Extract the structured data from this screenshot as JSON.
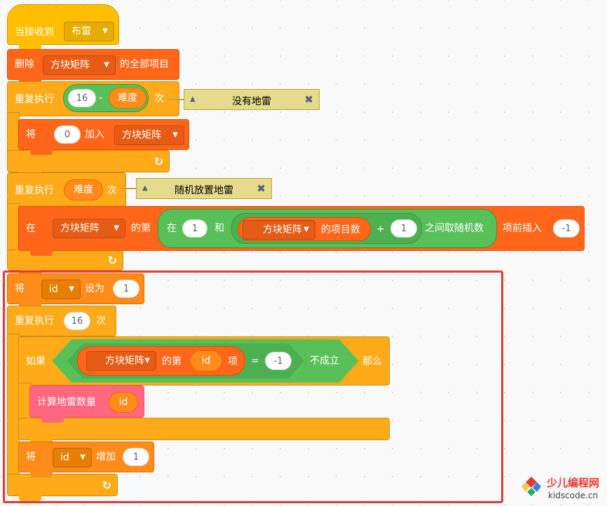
{
  "blocks": {
    "when_receive": {
      "label": "当接收到",
      "message": "布雷"
    },
    "delete_all": {
      "label": "删除",
      "list": "方块矩阵",
      "suffix": "的全部项目"
    },
    "repeat1": {
      "label": "重复执行",
      "num": "16",
      "minus": "-",
      "var": "难度",
      "suffix": "次",
      "comment": "没有地雷"
    },
    "add_to_list": {
      "label": "将",
      "value": "0",
      "mid": "加入",
      "list": "方块矩阵"
    },
    "repeat2": {
      "label": "重复执行",
      "var": "难度",
      "suffix": "次",
      "comment": "随机放置地雷"
    },
    "insert": {
      "label": "在",
      "list": "方块矩阵",
      "of": "的第",
      "random_label": "在",
      "from": "1",
      "and": "和",
      "len_list": "方块矩阵",
      "len_suffix": "的项目数",
      "plus": "+",
      "plus_num": "1",
      "random_suffix": "之间取随机数",
      "insert_label": "项前插入",
      "insert_value": "-1"
    },
    "set_var": {
      "label": "将",
      "var": "id",
      "mid": "设为",
      "value": "1"
    },
    "repeat3": {
      "label": "重复执行",
      "num": "16",
      "suffix": "次"
    },
    "if_block": {
      "label": "如果",
      "list": "方块矩阵",
      "of": "的第",
      "index": "id",
      "item": "项",
      "eq": "=",
      "eq_value": "-1",
      "not": "不成立",
      "then": "那么"
    },
    "custom": {
      "label": "计算地雷数量",
      "arg": "id"
    },
    "change_var": {
      "label": "将",
      "var": "id",
      "mid": "增加",
      "value": "1"
    }
  },
  "icons": {
    "loop": "loop-arrow-icon",
    "dropdown": "dropdown-caret-icon",
    "collapse": "collapse-triangle-icon",
    "close": "close-icon"
  },
  "watermark": {
    "title": "少儿编程网",
    "url": "kidscode.cn"
  },
  "colors": {
    "events": "#FFBF00",
    "control": "#FFAB19",
    "data": "#FF8C1A",
    "list": "#FF661A",
    "operators": "#59C059",
    "myblocks": "#FF6680",
    "highlight": "#E53935"
  }
}
